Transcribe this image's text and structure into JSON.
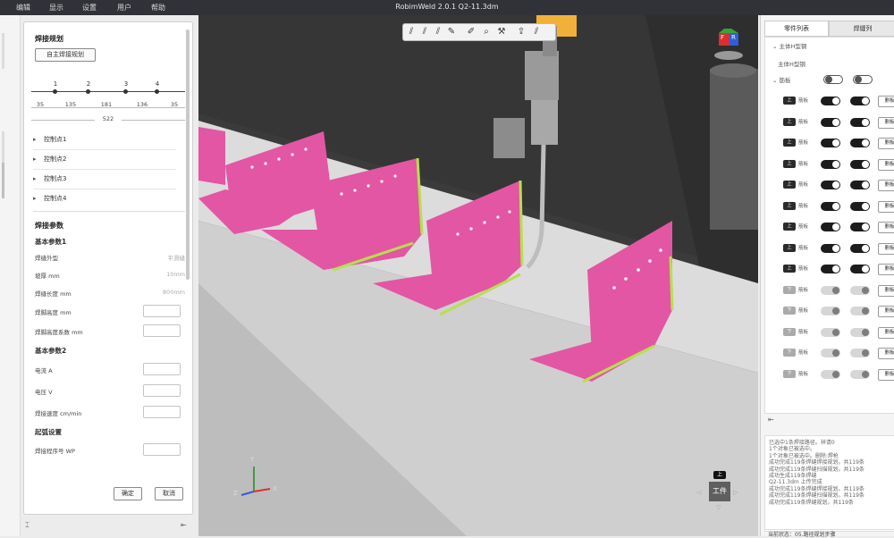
{
  "menu": [
    "编辑",
    "显示",
    "设置",
    "用户",
    "帮助"
  ],
  "window_title": "RobimWeld 2.0.1   Q2-11.3dm",
  "left_panel": {
    "title": "焊接规划",
    "auto_plan_button": "自主焊接规划",
    "timeline": {
      "points": [
        "1",
        "2",
        "3",
        "4"
      ],
      "segments": [
        "35",
        "135",
        "181",
        "136",
        "35"
      ],
      "total": "522"
    },
    "control_points": [
      "控制点1",
      "控制点2",
      "控制点3",
      "控制点4"
    ],
    "params_title": "焊接参数",
    "basic1_title": "基本参数1",
    "fields1": [
      {
        "label": "焊缝外型",
        "value": "平滑缝"
      },
      {
        "label": "坡厚 mm",
        "value": "10mm"
      },
      {
        "label": "焊缝长度 mm",
        "value": "800mm"
      },
      {
        "label": "焊脚高度 mm",
        "value": ""
      },
      {
        "label": "焊脚高度系数 mm",
        "value": ""
      }
    ],
    "basic2_title": "基本参数2",
    "fields2": [
      {
        "label": "电流 A",
        "value": ""
      },
      {
        "label": "电压 V",
        "value": ""
      },
      {
        "label": "焊接速度 cm/min",
        "value": ""
      }
    ],
    "start_title": "起弧设置",
    "fields3": [
      {
        "label": "焊接程序号 WP",
        "value": ""
      }
    ],
    "confirm_button": "确定",
    "cancel_button": "取消"
  },
  "viewport": {
    "work_label": "工件",
    "up_label": "上",
    "axes": {
      "x": "X",
      "y": "Y",
      "z": "Z"
    },
    "cube_faces": {
      "front": "F",
      "right": "R"
    }
  },
  "right_panel": {
    "tabs": [
      "零件列表",
      "焊缝列"
    ],
    "groups": [
      "主体H型钢",
      "主体H型钢"
    ],
    "subgroup": "筋板",
    "rows": [
      {
        "tag": "上",
        "text": "筋板",
        "on": true,
        "btn": "删板"
      },
      {
        "tag": "上",
        "text": "筋板",
        "on": true,
        "btn": "删板"
      },
      {
        "tag": "上",
        "text": "筋板",
        "on": true,
        "btn": "删板"
      },
      {
        "tag": "上",
        "text": "筋板",
        "on": true,
        "btn": "删板"
      },
      {
        "tag": "上",
        "text": "筋板",
        "on": true,
        "btn": "删板"
      },
      {
        "tag": "上",
        "text": "筋板",
        "on": true,
        "btn": "删板"
      },
      {
        "tag": "上",
        "text": "筋板",
        "on": true,
        "btn": "删板"
      },
      {
        "tag": "上",
        "text": "筋板",
        "on": true,
        "btn": "删板"
      },
      {
        "tag": "上",
        "text": "筋板",
        "on": true,
        "btn": "删板"
      },
      {
        "tag": "下",
        "text": "筋板",
        "on": false,
        "btn": "删板"
      },
      {
        "tag": "下",
        "text": "筋板",
        "on": false,
        "btn": "删板"
      },
      {
        "tag": "下",
        "text": "筋板",
        "on": false,
        "btn": "删板"
      },
      {
        "tag": "下",
        "text": "筋板",
        "on": false,
        "btn": "删板"
      },
      {
        "tag": "下",
        "text": "筋板",
        "on": false,
        "btn": "删板"
      }
    ],
    "log": [
      "已选中1条焊接路径。祥请0",
      "1个对象已被选中。",
      "1个对象已被选中。删除:焊枪",
      "成功完成119条焊缝焊接规划。共119条",
      "成功完成119条焊缝扫描规划。共119条",
      "成功生成119条焊缝",
      "Q2-11.3dm 上传完成",
      "成功完成119条焊缝焊接规划。共119条",
      "成功完成119条焊缝扫描规划。共119条",
      "成功完成119条焊缝规划。共119条"
    ],
    "status": "当前状态：05.路径规划步骤"
  }
}
